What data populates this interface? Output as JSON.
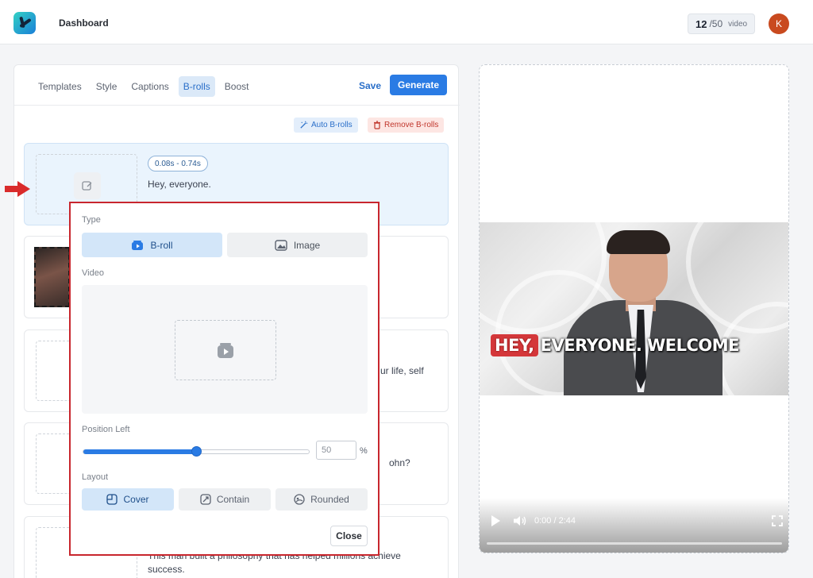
{
  "header": {
    "title": "Dashboard",
    "counter": {
      "current": "12",
      "total": "/50",
      "unit": "video"
    },
    "avatar_initial": "K"
  },
  "tabs": [
    {
      "label": "Templates",
      "active": false
    },
    {
      "label": "Style",
      "active": false
    },
    {
      "label": "Captions",
      "active": false
    },
    {
      "label": "B-rolls",
      "active": true
    },
    {
      "label": "Boost",
      "active": false
    }
  ],
  "actions": {
    "save": "Save",
    "generate": "Generate"
  },
  "broll_actions": {
    "auto": "Auto B-rolls",
    "remove": "Remove B-rolls"
  },
  "segments": [
    {
      "time": "0.08s - 0.74s",
      "text": "Hey, everyone."
    },
    {
      "text": "ur life, self"
    },
    {
      "text": "ohn?"
    },
    {
      "text": "This man built a philosophy that has helped millions achieve",
      "text2": "success."
    }
  ],
  "popup": {
    "type_label": "Type",
    "type_options": [
      {
        "label": "B-roll",
        "selected": true
      },
      {
        "label": "Image",
        "selected": false
      }
    ],
    "video_label": "Video",
    "position_label": "Position Left",
    "position_value": "50",
    "position_fraction": 0.5,
    "position_unit": "%",
    "layout_label": "Layout",
    "layout_options": [
      {
        "label": "Cover",
        "selected": true
      },
      {
        "label": "Contain",
        "selected": false
      },
      {
        "label": "Rounded",
        "selected": false
      }
    ],
    "close": "Close"
  },
  "preview": {
    "caption_highlight": "HEY,",
    "caption_rest": "EVERYONE. WELCOME",
    "time": "0:00 / 2:44"
  },
  "colors": {
    "accent": "#2a7be4",
    "popup_border": "#c8262d",
    "arrow": "#d92b2b",
    "caption_highlight": "#d4373a"
  }
}
